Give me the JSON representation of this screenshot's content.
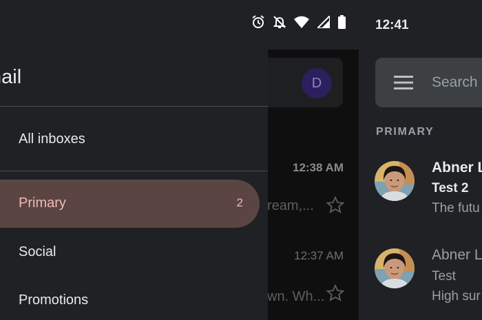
{
  "left_status": {
    "icons": [
      "alarm-icon",
      "notifications-off-icon",
      "wifi-icon",
      "signal-icon",
      "battery-icon"
    ]
  },
  "drawer": {
    "title": "nail",
    "items": [
      {
        "label": "All inboxes"
      },
      {
        "label": "Primary",
        "count": "2",
        "selected": true
      },
      {
        "label": "Social"
      },
      {
        "label": "Promotions"
      }
    ]
  },
  "background_inbox": {
    "avatar_letter": "D",
    "rows": [
      {
        "time": "12:38 AM",
        "snippet": "ream,..."
      },
      {
        "time": "12:37 AM",
        "snippet": "wn. Wh..."
      }
    ]
  },
  "right_status": {
    "time": "12:41"
  },
  "inbox": {
    "search_placeholder": "Search",
    "section": "PRIMARY",
    "emails": [
      {
        "sender": "Abner L",
        "subject": "Test 2",
        "snippet": "The futu",
        "unread": true
      },
      {
        "sender": "Abner L",
        "subject": "Test",
        "snippet": "High sur",
        "unread": false
      }
    ]
  },
  "colors": {
    "background": "#202124",
    "drawer_selected": "#5b4543",
    "drawer_selected_text": "#f2b8b5",
    "search_bar": "#3c4043"
  }
}
